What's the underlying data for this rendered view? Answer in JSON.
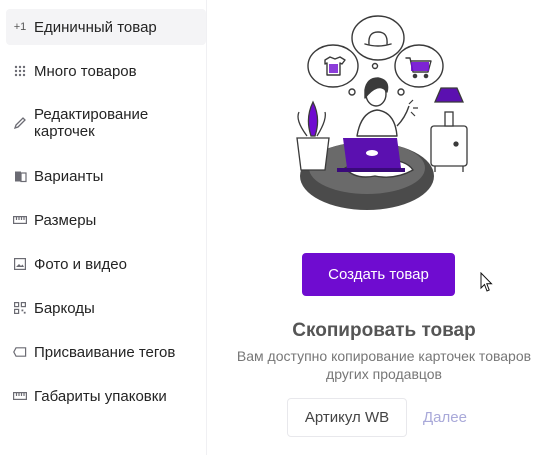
{
  "sidebar": {
    "items": [
      {
        "label": "Единичный товар",
        "icon": "plus-one-icon",
        "active": true
      },
      {
        "label": "Много товаров",
        "icon": "grid-dots-icon"
      },
      {
        "label": "Редактирование карточек",
        "icon": "pencil-icon"
      },
      {
        "label": "Варианты",
        "icon": "variants-icon"
      },
      {
        "label": "Размеры",
        "icon": "ruler-icon"
      },
      {
        "label": "Фото и видео",
        "icon": "image-icon"
      },
      {
        "label": "Баркоды",
        "icon": "qr-code-icon"
      },
      {
        "label": "Присваивание тегов",
        "icon": "tag-icon"
      },
      {
        "label": "Габариты упаковки",
        "icon": "ruler-icon"
      }
    ],
    "plus_one_glyph": "+1"
  },
  "main": {
    "create_button_label": "Создать товар",
    "copy_title": "Скопировать товар",
    "copy_description": "Вам доступно копирование карточек товаров других продавцов",
    "sku_placeholder": "Артикул WB",
    "next_label": "Далее"
  },
  "colors": {
    "accent": "#6f0cd0",
    "next_link": "#a9a9d9"
  }
}
